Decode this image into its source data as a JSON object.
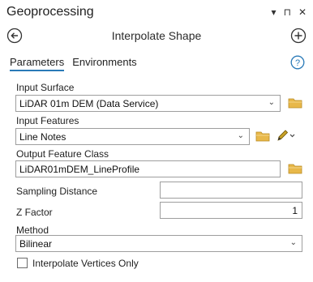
{
  "pane": {
    "title": "Geoprocessing",
    "controls": [
      "▾",
      "⊓",
      "✕"
    ]
  },
  "tool": {
    "title": "Interpolate Shape"
  },
  "tabs": [
    {
      "label": "Parameters",
      "active": true
    },
    {
      "label": "Environments",
      "active": false
    }
  ],
  "params": {
    "input_surface": {
      "label": "Input Surface",
      "value": "LiDAR 01m DEM (Data Service)"
    },
    "input_features": {
      "label": "Input Features",
      "value": "Line Notes"
    },
    "output_fc": {
      "label": "Output Feature Class",
      "value": "LiDAR01mDEM_LineProfile"
    },
    "sampling_distance": {
      "label": "Sampling Distance",
      "value": ""
    },
    "z_factor": {
      "label": "Z Factor",
      "value": "1"
    },
    "method": {
      "label": "Method",
      "value": "Bilinear"
    },
    "interpolate_vertices": {
      "label": "Interpolate Vertices Only",
      "checked": false
    }
  },
  "colors": {
    "accent": "#2a7ab8",
    "folder": "#e8b84a",
    "pencil": "#c9a227"
  },
  "icons": [
    "back-arrow-icon",
    "add-circle-icon",
    "help-icon",
    "folder-icon",
    "pencil-icon",
    "chevron-down-icon"
  ]
}
